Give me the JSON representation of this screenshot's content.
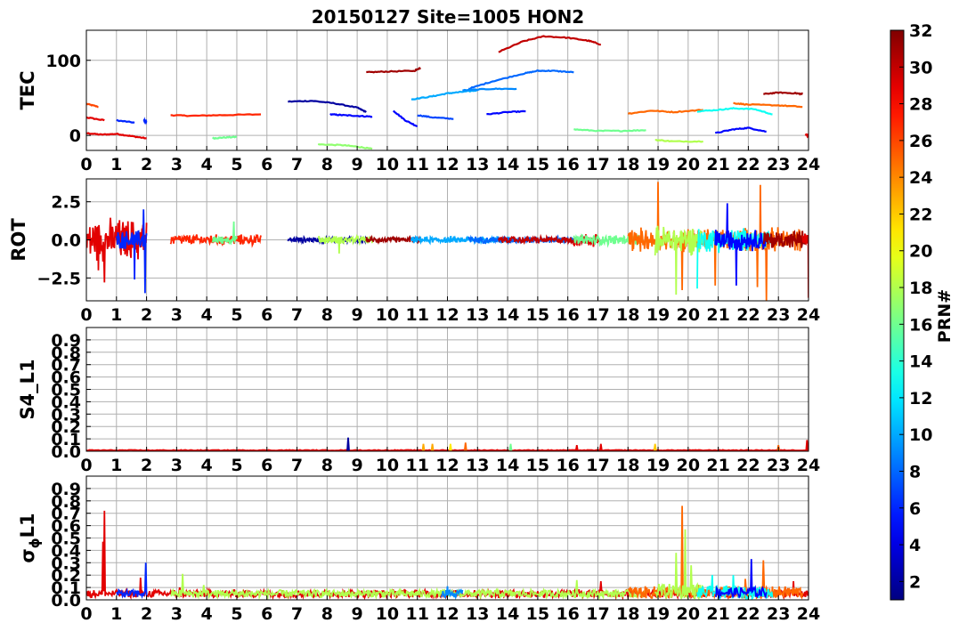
{
  "figure": {
    "title": "20150127 Site=1005 HON2"
  },
  "colorbar": {
    "label": "PRN#",
    "min": 1,
    "max": 32,
    "ticks": [
      2,
      4,
      6,
      8,
      10,
      12,
      14,
      16,
      18,
      20,
      22,
      24,
      26,
      28,
      30,
      32
    ],
    "colormap": "jet"
  },
  "chart_data": [
    {
      "type": "line",
      "panel": "TEC",
      "ylabel": "TEC",
      "xlim": [
        0,
        24
      ],
      "ylim": [
        -20,
        140
      ],
      "xticks": [
        0,
        1,
        2,
        3,
        4,
        5,
        6,
        7,
        8,
        9,
        10,
        11,
        12,
        13,
        14,
        15,
        16,
        17,
        18,
        19,
        20,
        21,
        22,
        23,
        24
      ],
      "yticks": [
        0,
        100
      ],
      "grid": true,
      "series": [
        {
          "prn": 26,
          "x": [
            0,
            0.4
          ],
          "y": [
            42,
            38
          ]
        },
        {
          "prn": 29,
          "x": [
            0,
            0.6
          ],
          "y": [
            24,
            20
          ]
        },
        {
          "prn": 29,
          "x": [
            0,
            0.5,
            1,
            1.5,
            2.0
          ],
          "y": [
            3,
            1,
            2,
            -1,
            -4
          ]
        },
        {
          "prn": 6,
          "x": [
            1.0,
            1.6
          ],
          "y": [
            20,
            17
          ]
        },
        {
          "prn": 6,
          "x": [
            1.9,
            2.0
          ],
          "y": [
            20,
            18
          ]
        },
        {
          "prn": 27,
          "x": [
            2.8,
            3.5,
            4.5,
            5.8
          ],
          "y": [
            27,
            26,
            27,
            28
          ]
        },
        {
          "prn": 16,
          "x": [
            4.2,
            4.5,
            5.0
          ],
          "y": [
            -4,
            -3,
            -2
          ]
        },
        {
          "prn": 2,
          "x": [
            6.7,
            7.5,
            8.2,
            9.0,
            9.3
          ],
          "y": [
            45,
            46,
            43,
            37,
            31
          ]
        },
        {
          "prn": 5,
          "x": [
            8.1,
            8.5,
            9.0,
            9.5
          ],
          "y": [
            28,
            27,
            26,
            25
          ]
        },
        {
          "prn": 17,
          "x": [
            7.7,
            8.5,
            9.0,
            9.5
          ],
          "y": [
            -12,
            -13,
            -15,
            -18
          ]
        },
        {
          "prn": 31,
          "x": [
            9.3,
            10.0,
            10.9
          ],
          "y": [
            84,
            85,
            86
          ]
        },
        {
          "prn": 31,
          "x": [
            10.9,
            11.1
          ],
          "y": [
            86,
            90
          ]
        },
        {
          "prn": 5,
          "x": [
            10.2,
            10.6,
            11.0
          ],
          "y": [
            33,
            20,
            12
          ]
        },
        {
          "prn": 10,
          "x": [
            10.8,
            11.5,
            12.0,
            12.5,
            13.0
          ],
          "y": [
            48,
            52,
            56,
            58,
            60
          ]
        },
        {
          "prn": 7,
          "x": [
            11.0,
            11.5,
            12.2
          ],
          "y": [
            27,
            24,
            22
          ]
        },
        {
          "prn": 8,
          "x": [
            12.7,
            13.5,
            14.5,
            15.0,
            15.5,
            16.2
          ],
          "y": [
            62,
            72,
            82,
            86,
            86,
            84
          ]
        },
        {
          "prn": 9,
          "x": [
            12.5,
            13.5,
            14.3
          ],
          "y": [
            60,
            62,
            62
          ]
        },
        {
          "prn": 5,
          "x": [
            13.3,
            14.0,
            14.6
          ],
          "y": [
            28,
            31,
            32
          ]
        },
        {
          "prn": 30,
          "x": [
            13.7,
            14.5,
            15.2,
            16.0,
            16.7,
            17.1
          ],
          "y": [
            111,
            125,
            132,
            130,
            126,
            121
          ]
        },
        {
          "prn": 16,
          "x": [
            16.2,
            17.0,
            17.8,
            18.6
          ],
          "y": [
            8,
            6,
            6,
            7
          ]
        },
        {
          "prn": 25,
          "x": [
            18.0,
            18.8,
            19.5,
            20.5
          ],
          "y": [
            29,
            33,
            31,
            34
          ]
        },
        {
          "prn": 18,
          "x": [
            18.9,
            19.5,
            20.5
          ],
          "y": [
            -6,
            -8,
            -8
          ]
        },
        {
          "prn": 13,
          "x": [
            20.3,
            21.0,
            21.5,
            22.2,
            22.8
          ],
          "y": [
            32,
            34,
            36,
            35,
            28
          ]
        },
        {
          "prn": 5,
          "x": [
            20.9,
            21.5,
            22.0,
            22.6
          ],
          "y": [
            3,
            8,
            10,
            5
          ]
        },
        {
          "prn": 25,
          "x": [
            21.5,
            22.0,
            23.0,
            23.8
          ],
          "y": [
            43,
            41,
            40,
            38
          ]
        },
        {
          "prn": 31,
          "x": [
            22.5,
            23.0,
            23.6,
            23.8
          ],
          "y": [
            55,
            57,
            56,
            55
          ]
        },
        {
          "prn": 29,
          "x": [
            23.9,
            24.0
          ],
          "y": [
            2,
            -2
          ]
        }
      ]
    },
    {
      "type": "line",
      "panel": "ROT",
      "ylabel": "ROT",
      "xlim": [
        0,
        24
      ],
      "ylim": [
        -4,
        4
      ],
      "xticks": [
        0,
        1,
        2,
        3,
        4,
        5,
        6,
        7,
        8,
        9,
        10,
        11,
        12,
        13,
        14,
        15,
        16,
        17,
        18,
        19,
        20,
        21,
        22,
        23,
        24
      ],
      "yticks": [
        2.5,
        0.0,
        -2.5
      ],
      "ytick_labels": [
        "2.5",
        "0.0",
        "−2.5"
      ],
      "grid": true,
      "series": [
        {
          "prn": 29,
          "x": [
            0.0,
            2.0
          ],
          "amp": 1.6,
          "spikes": [
            [
              0.6,
              3.0
            ],
            [
              0.6,
              -2.8
            ],
            [
              0.4,
              -2.0
            ]
          ]
        },
        {
          "prn": 6,
          "x": [
            1.0,
            2.0
          ],
          "amp": 0.7,
          "spikes": [
            [
              1.9,
              2.0
            ],
            [
              1.95,
              -3.5
            ],
            [
              1.6,
              -2.6
            ]
          ]
        },
        {
          "prn": 27,
          "x": [
            2.8,
            5.8
          ],
          "amp": 0.4,
          "spikes": []
        },
        {
          "prn": 16,
          "x": [
            4.2,
            5.0
          ],
          "amp": 0.3,
          "spikes": [
            [
              4.9,
              1.2
            ]
          ]
        },
        {
          "prn": 2,
          "x": [
            6.7,
            9.3
          ],
          "amp": 0.2,
          "spikes": []
        },
        {
          "prn": 18,
          "x": [
            7.7,
            9.5
          ],
          "amp": 0.3,
          "spikes": [
            [
              8.4,
              -0.9
            ]
          ]
        },
        {
          "prn": 31,
          "x": [
            9.3,
            11.1
          ],
          "amp": 0.2,
          "spikes": []
        },
        {
          "prn": 10,
          "x": [
            10.8,
            14.3
          ],
          "amp": 0.25,
          "spikes": []
        },
        {
          "prn": 8,
          "x": [
            12.7,
            16.2
          ],
          "amp": 0.25,
          "spikes": []
        },
        {
          "prn": 30,
          "x": [
            13.7,
            17.1
          ],
          "amp": 0.25,
          "spikes": []
        },
        {
          "prn": 29,
          "x": [
            16.2,
            17.0
          ],
          "amp": 0.5,
          "spikes": []
        },
        {
          "prn": 16,
          "x": [
            16.2,
            18.6
          ],
          "amp": 0.4,
          "spikes": []
        },
        {
          "prn": 25,
          "x": [
            18.0,
            23.8
          ],
          "amp": 0.9,
          "spikes": [
            [
              19.0,
              3.8
            ],
            [
              22.4,
              3.6
            ],
            [
              20.9,
              -3.0
            ],
            [
              22.3,
              -3.1
            ],
            [
              19.8,
              -3.3
            ],
            [
              22.6,
              -4.0
            ]
          ]
        },
        {
          "prn": 18,
          "x": [
            18.9,
            20.5
          ],
          "amp": 1.1,
          "spikes": [
            [
              19.6,
              -3.6
            ]
          ]
        },
        {
          "prn": 13,
          "x": [
            20.3,
            22.8
          ],
          "amp": 0.9,
          "spikes": [
            [
              20.0,
              -3.2
            ]
          ]
        },
        {
          "prn": 5,
          "x": [
            20.9,
            22.6
          ],
          "amp": 0.8,
          "spikes": [
            [
              21.3,
              2.4
            ],
            [
              21.6,
              -3.0
            ]
          ]
        },
        {
          "prn": 31,
          "x": [
            22.5,
            23.9
          ],
          "amp": 0.7,
          "spikes": []
        },
        {
          "prn": 29,
          "x": [
            23.8,
            24.0
          ],
          "amp": 0.5,
          "spikes": [
            [
              24.0,
              -3.8
            ]
          ]
        }
      ]
    },
    {
      "type": "line",
      "panel": "S4_L1",
      "ylabel": "S4_L1",
      "xlim": [
        0,
        24
      ],
      "ylim": [
        0,
        1
      ],
      "xticks": [
        0,
        1,
        2,
        3,
        4,
        5,
        6,
        7,
        8,
        9,
        10,
        11,
        12,
        13,
        14,
        15,
        16,
        17,
        18,
        19,
        20,
        21,
        22,
        23,
        24
      ],
      "yticks": [
        0.0,
        0.1,
        0.2,
        0.3,
        0.4,
        0.5,
        0.6,
        0.7,
        0.8,
        0.9
      ],
      "ytick_labels": [
        "0.0",
        "0.1",
        "0.2",
        "0.3",
        "0.4",
        "0.5",
        "0.6",
        "0.7",
        "0.8",
        "0.9"
      ],
      "grid": true,
      "spikes": [
        {
          "prn": 2,
          "x": 8.7,
          "y": 0.11
        },
        {
          "prn": 23,
          "x": 11.2,
          "y": 0.06
        },
        {
          "prn": 23,
          "x": 11.5,
          "y": 0.06
        },
        {
          "prn": 21,
          "x": 12.1,
          "y": 0.06
        },
        {
          "prn": 25,
          "x": 12.6,
          "y": 0.07
        },
        {
          "prn": 16,
          "x": 14.1,
          "y": 0.06
        },
        {
          "prn": 29,
          "x": 16.3,
          "y": 0.05
        },
        {
          "prn": 29,
          "x": 17.1,
          "y": 0.06
        },
        {
          "prn": 22,
          "x": 18.9,
          "y": 0.06
        },
        {
          "prn": 25,
          "x": 23.0,
          "y": 0.05
        },
        {
          "prn": 29,
          "x": 23.95,
          "y": 0.09
        }
      ]
    },
    {
      "type": "line",
      "panel": "sigma_phi_L1",
      "ylabel": "σ",
      "ylabel_sub": "ϕ",
      "ylabel_suffix": "L1",
      "xlim": [
        0,
        24
      ],
      "ylim": [
        0,
        1
      ],
      "xticks": [
        0,
        1,
        2,
        3,
        4,
        5,
        6,
        7,
        8,
        9,
        10,
        11,
        12,
        13,
        14,
        15,
        16,
        17,
        18,
        19,
        20,
        21,
        22,
        23,
        24
      ],
      "yticks": [
        0.0,
        0.1,
        0.2,
        0.3,
        0.4,
        0.5,
        0.6,
        0.7,
        0.8,
        0.9
      ],
      "ytick_labels": [
        "0.0",
        "0.1",
        "0.2",
        "0.3",
        "0.4",
        "0.5",
        "0.6",
        "0.7",
        "0.8",
        "0.9"
      ],
      "grid": true,
      "series": [
        {
          "prn": 29,
          "x": [
            0.0,
            24.0
          ],
          "base": 0.05,
          "noise": 0.03,
          "spikes": [
            [
              0.6,
              0.72
            ],
            [
              0.55,
              0.47
            ],
            [
              1.8,
              0.18
            ],
            [
              3.1,
              0.1
            ],
            [
              17.1,
              0.15
            ],
            [
              23.5,
              0.15
            ]
          ]
        },
        {
          "prn": 6,
          "x": [
            1.0,
            2.0
          ],
          "base": 0.05,
          "noise": 0.03,
          "spikes": [
            [
              1.98,
              0.3
            ]
          ]
        },
        {
          "prn": 18,
          "x": [
            2.8,
            18.6
          ],
          "base": 0.05,
          "noise": 0.03,
          "spikes": [
            [
              3.2,
              0.21
            ],
            [
              3.9,
              0.12
            ],
            [
              16.3,
              0.16
            ]
          ]
        },
        {
          "prn": 25,
          "x": [
            18.0,
            23.8
          ],
          "base": 0.06,
          "noise": 0.05,
          "spikes": [
            [
              19.8,
              0.76
            ],
            [
              22.5,
              0.32
            ],
            [
              21.9,
              0.17
            ]
          ]
        },
        {
          "prn": 18,
          "x": [
            18.9,
            20.5
          ],
          "base": 0.07,
          "noise": 0.06,
          "spikes": [
            [
              19.9,
              0.57
            ],
            [
              19.6,
              0.38
            ],
            [
              20.1,
              0.28
            ]
          ]
        },
        {
          "prn": 13,
          "x": [
            20.3,
            22.8
          ],
          "base": 0.06,
          "noise": 0.05,
          "spikes": [
            [
              20.8,
              0.2
            ],
            [
              21.5,
              0.2
            ]
          ]
        },
        {
          "prn": 5,
          "x": [
            20.9,
            22.6
          ],
          "base": 0.06,
          "noise": 0.04,
          "spikes": [
            [
              22.1,
              0.33
            ]
          ]
        },
        {
          "prn": 9,
          "x": [
            11.8,
            12.5
          ],
          "base": 0.05,
          "noise": 0.03,
          "spikes": [
            [
              12.0,
              0.11
            ],
            [
              12.6,
              0.08
            ]
          ]
        }
      ]
    }
  ]
}
